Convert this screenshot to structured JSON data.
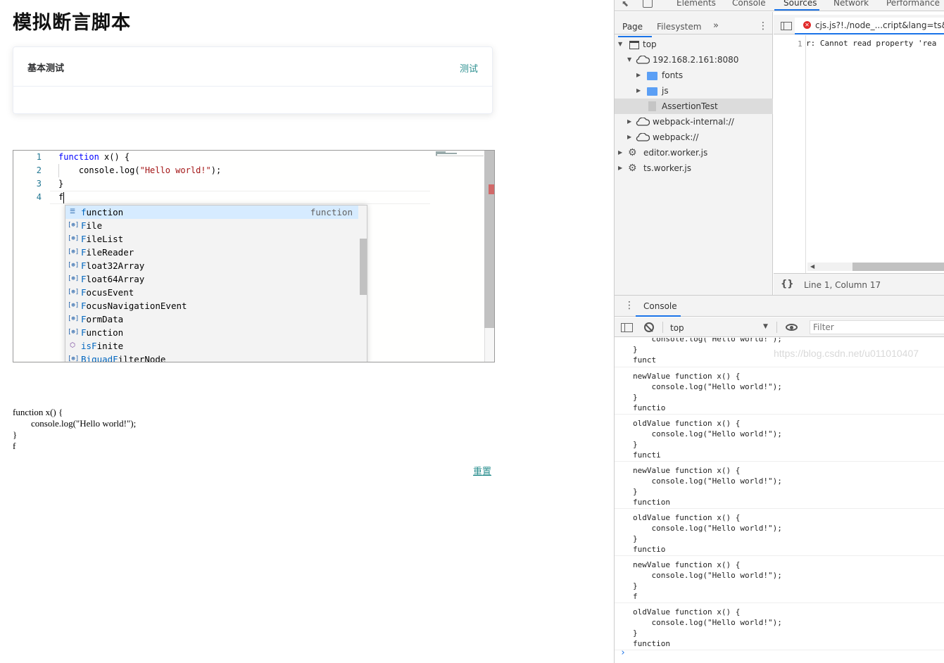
{
  "app": {
    "title": "模拟断言脚本",
    "card": {
      "title": "基本测试",
      "action": "测试"
    },
    "editor": {
      "line_numbers": [
        "1",
        "2",
        "3",
        "4"
      ],
      "lines": {
        "l1_kw": "function",
        "l1_rest": " x() {",
        "l2_pre": "    console.log(",
        "l2_str": "\"Hello world!\"",
        "l2_post": ");",
        "l3": "}",
        "l4": "f"
      },
      "suggestions": [
        {
          "icon": "keyword-snippet-icon",
          "match": "f",
          "rest": "unction",
          "detail": "function"
        },
        {
          "icon": "variable-icon",
          "match": "F",
          "rest": "ile",
          "detail": ""
        },
        {
          "icon": "variable-icon",
          "match": "F",
          "rest": "ileList",
          "detail": ""
        },
        {
          "icon": "variable-icon",
          "match": "F",
          "rest": "ileReader",
          "detail": ""
        },
        {
          "icon": "variable-icon",
          "match": "F",
          "rest": "loat32Array",
          "detail": ""
        },
        {
          "icon": "variable-icon",
          "match": "F",
          "rest": "loat64Array",
          "detail": ""
        },
        {
          "icon": "variable-icon",
          "match": "F",
          "rest": "ocusEvent",
          "detail": ""
        },
        {
          "icon": "variable-icon",
          "match": "F",
          "rest": "ocusNavigationEvent",
          "detail": ""
        },
        {
          "icon": "variable-icon",
          "match": "F",
          "rest": "ormData",
          "detail": ""
        },
        {
          "icon": "variable-icon",
          "match": "F",
          "rest": "unction",
          "detail": ""
        },
        {
          "icon": "method-cube-icon",
          "match": "isF",
          "rest": "inite",
          "detail": ""
        },
        {
          "icon": "variable-icon",
          "match": "BiquadF",
          "rest": "ilterNode",
          "detail": ""
        }
      ]
    },
    "plain_code": "function x() {\n        console.log(\"Hello world!\");\n}\nf",
    "reset_label": "重置"
  },
  "devtools": {
    "tabs": [
      "Elements",
      "Console",
      "Sources",
      "Network",
      "Performance"
    ],
    "active_tab": "Sources",
    "navigator": {
      "tabs": [
        "Page",
        "Filesystem"
      ],
      "more": "»",
      "tree": [
        {
          "label": "top",
          "icon": "frame-icon"
        },
        {
          "label": "192.168.2.161:8080",
          "icon": "cloud-icon"
        },
        {
          "label": "fonts",
          "icon": "folder-icon"
        },
        {
          "label": "js",
          "icon": "folder-icon"
        },
        {
          "label": "AssertionTest",
          "icon": "file-icon"
        },
        {
          "label": "webpack-internal://",
          "icon": "cloud-icon"
        },
        {
          "label": "webpack://",
          "icon": "cloud-icon"
        },
        {
          "label": "editor.worker.js",
          "icon": "gear-icon"
        },
        {
          "label": "ts.worker.js",
          "icon": "gear-icon"
        }
      ]
    },
    "source": {
      "tab_label": "cjs.js?!./node_...cript&lang=ts&",
      "line_number": "1",
      "line_text": "r: Cannot read property 'rea",
      "pretty_print": "{}",
      "status": "Line 1, Column 17"
    },
    "drawer": {
      "tab": "Console",
      "context": "top",
      "filter_placeholder": "Filter",
      "log": [
        [
          "    console.log(\"Hello world!\");",
          "}",
          "funct"
        ],
        [
          "newValue function x() {",
          "    console.log(\"Hello world!\");",
          "}",
          "functio"
        ],
        [
          "oldValue function x() {",
          "    console.log(\"Hello world!\");",
          "}",
          "functi"
        ],
        [
          "newValue function x() {",
          "    console.log(\"Hello world!\");",
          "}",
          "function"
        ],
        [
          "oldValue function x() {",
          "    console.log(\"Hello world!\");",
          "}",
          "functio"
        ],
        [
          "newValue function x() {",
          "    console.log(\"Hello world!\");",
          "}",
          "f"
        ],
        [
          "oldValue function x() {",
          "    console.log(\"Hello world!\");",
          "}",
          "function"
        ]
      ],
      "prompt": "›"
    },
    "watermark": "https://blog.csdn.net/u011010407"
  }
}
